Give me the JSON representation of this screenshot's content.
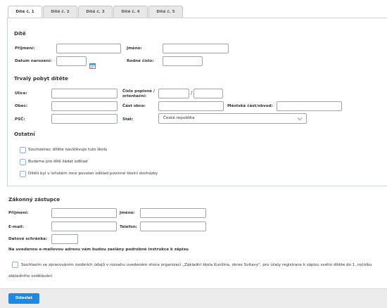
{
  "tabs": [
    "Dítě č. 1",
    "Dítě č. 2",
    "Dítě č. 3",
    "Dítě č. 4",
    "Dítě č. 5"
  ],
  "child": {
    "section_title": "Dítě",
    "surname_label": "Příjmení:",
    "firstname_label": "Jméno:",
    "birthdate_label": "Datum narození:",
    "birthnumber_label": "Rodné číslo:"
  },
  "residence": {
    "section_title": "Trvalý pobyt dítěte",
    "street_label": "Ulice:",
    "house_number_label": "Číslo popisné / orientační:",
    "house_number_separator": "/",
    "city_label": "Obec:",
    "city_part_label": "Část obce:",
    "district_label": "Městská část/obvod:",
    "zip_label": "PSČ:",
    "country_label": "Stát:",
    "country_value": "Česká republika"
  },
  "other": {
    "section_title": "Ostatní",
    "sibling_label": "Sourozenec dítěte navštěvuje tuto školu",
    "deferral_label": "Budeme pro dítě žádat odklad",
    "prior_deferral_label": "Dítěti byl v loňském roce povolen odklad povinné školní docházky"
  },
  "guardian": {
    "section_title": "Zákonný zástupce",
    "surname_label": "Příjmení:",
    "firstname_label": "Jméno:",
    "email_label": "E-mail:",
    "phone_label": "Telefon:",
    "databox_label": "Datové schránka:",
    "email_note": "Na uvedenou e-mailovou adresu vám budou zaslány podrobné instrukce k zápisu"
  },
  "consent": {
    "text_line1": "Souhlasím se zpracováním osobních údajů v rozsahu uvedeném shora organizací „Základní škola Kunžina, okres Svitavy\", pro účely registrace k zápisu svého dítěte do 1. ročníku",
    "text_line2": "základního vzdělávání"
  },
  "submit_label": "Odeslat",
  "colors": {
    "accent": "#1e88e5",
    "border": "#9fa6ae",
    "checkbox_border": "#8fb4d6"
  },
  "icons": {
    "calendar": "calendar-icon",
    "chevron": "chevron-down-icon"
  }
}
